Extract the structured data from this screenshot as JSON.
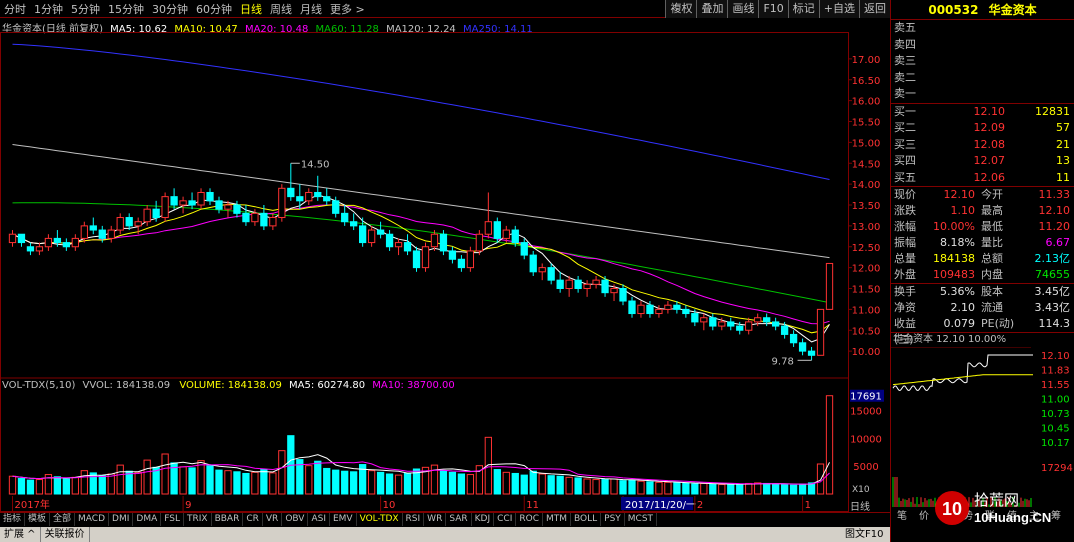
{
  "topbar": {
    "tabs": [
      "分时",
      "1分钟",
      "5分钟",
      "15分钟",
      "30分钟",
      "60分钟",
      "日线",
      "周线",
      "月线",
      "更多 >"
    ],
    "active_tab": "日线",
    "right_buttons": [
      "複权",
      "叠加",
      "画线",
      "F10",
      "标记",
      "+自选",
      "返回"
    ]
  },
  "chart_header": {
    "name": "华金资本(日线 前复权)",
    "ma5": "MA5: 10.62",
    "ma10": "MA10: 10.47",
    "ma20": "MA20: 10.48",
    "ma60": "MA60: 11.28",
    "ma120": "MA120: 12.24",
    "ma250": "MA250: 14.11"
  },
  "price_axis": [
    "17.00",
    "16.50",
    "16.00",
    "15.50",
    "15.00",
    "14.50",
    "14.00",
    "13.50",
    "13.00",
    "12.50",
    "12.00",
    "11.50",
    "11.00",
    "10.50",
    "10.00"
  ],
  "annotations": {
    "high": "14.50",
    "low": "9.78"
  },
  "volume_header": {
    "label": "VOL-TDX(5,10)",
    "vvol": "VVOL: 184138.09",
    "volume": "VOLUME: 184138.09",
    "ma5": "MA5: 60274.80",
    "ma10": "MA10: 38700.00"
  },
  "volume_axis": {
    "top": "17691",
    "ticks": [
      "15000",
      "10000",
      "5000"
    ],
    "unit": "X10"
  },
  "date_axis": {
    "labels": [
      "2017年",
      "9",
      "10",
      "11",
      "2017/11/20/一",
      "2",
      "1"
    ]
  },
  "colors": {
    "up": "#ff3232",
    "down": "#00ffff",
    "ma5": "#ffffff",
    "ma10": "#ffff00",
    "ma20": "#ff00ff",
    "ma60": "#00c000",
    "ma120": "#c0c0c0",
    "ma250": "#3232ff",
    "frame": "#800000"
  },
  "chart_data": {
    "type": "candlestick",
    "title": "华金资本(日线 前复权)",
    "ylim": [
      9.5,
      17.5
    ],
    "candles": [
      [
        12.6,
        12.9,
        12.5,
        12.8
      ],
      [
        12.8,
        12.8,
        12.5,
        12.6
      ],
      [
        12.5,
        12.6,
        12.3,
        12.4
      ],
      [
        12.4,
        12.6,
        12.3,
        12.5
      ],
      [
        12.5,
        12.8,
        12.4,
        12.7
      ],
      [
        12.7,
        12.9,
        12.5,
        12.6
      ],
      [
        12.6,
        12.7,
        12.4,
        12.5
      ],
      [
        12.5,
        12.8,
        12.4,
        12.7
      ],
      [
        12.7,
        13.1,
        12.6,
        13.0
      ],
      [
        13.0,
        13.2,
        12.8,
        12.9
      ],
      [
        12.9,
        13.0,
        12.6,
        12.7
      ],
      [
        12.7,
        13.0,
        12.6,
        12.9
      ],
      [
        12.9,
        13.3,
        12.8,
        13.2
      ],
      [
        13.2,
        13.3,
        12.9,
        13.0
      ],
      [
        13.0,
        13.2,
        12.8,
        13.1
      ],
      [
        13.1,
        13.5,
        13.0,
        13.4
      ],
      [
        13.4,
        13.6,
        13.1,
        13.2
      ],
      [
        13.2,
        13.8,
        13.1,
        13.7
      ],
      [
        13.7,
        13.9,
        13.4,
        13.5
      ],
      [
        13.5,
        13.7,
        13.3,
        13.6
      ],
      [
        13.6,
        13.8,
        13.4,
        13.5
      ],
      [
        13.5,
        13.9,
        13.4,
        13.8
      ],
      [
        13.8,
        13.9,
        13.5,
        13.6
      ],
      [
        13.6,
        13.7,
        13.3,
        13.4
      ],
      [
        13.4,
        13.6,
        13.2,
        13.5
      ],
      [
        13.5,
        13.6,
        13.2,
        13.3
      ],
      [
        13.3,
        13.5,
        13.0,
        13.1
      ],
      [
        13.1,
        13.4,
        13.0,
        13.3
      ],
      [
        13.3,
        13.5,
        12.9,
        13.0
      ],
      [
        13.0,
        13.3,
        12.9,
        13.2
      ],
      [
        13.2,
        14.0,
        13.1,
        13.9
      ],
      [
        13.9,
        14.5,
        13.6,
        13.7
      ],
      [
        13.7,
        14.0,
        13.4,
        13.6
      ],
      [
        13.6,
        13.9,
        13.5,
        13.8
      ],
      [
        13.8,
        14.2,
        13.6,
        13.7
      ],
      [
        13.7,
        13.9,
        13.5,
        13.6
      ],
      [
        13.6,
        13.7,
        13.2,
        13.3
      ],
      [
        13.3,
        13.5,
        13.0,
        13.1
      ],
      [
        13.1,
        13.3,
        12.9,
        13.0
      ],
      [
        13.0,
        13.2,
        12.5,
        12.6
      ],
      [
        12.6,
        13.0,
        12.5,
        12.9
      ],
      [
        12.9,
        13.1,
        12.7,
        12.8
      ],
      [
        12.8,
        12.9,
        12.4,
        12.5
      ],
      [
        12.5,
        12.7,
        12.3,
        12.6
      ],
      [
        12.6,
        12.8,
        12.3,
        12.4
      ],
      [
        12.4,
        12.5,
        11.9,
        12.0
      ],
      [
        12.0,
        12.6,
        11.9,
        12.5
      ],
      [
        12.5,
        12.9,
        12.4,
        12.8
      ],
      [
        12.8,
        12.9,
        12.3,
        12.4
      ],
      [
        12.4,
        12.5,
        12.1,
        12.2
      ],
      [
        12.2,
        12.3,
        11.9,
        12.0
      ],
      [
        12.0,
        12.5,
        11.9,
        12.4
      ],
      [
        12.4,
        12.9,
        12.3,
        12.8
      ],
      [
        12.8,
        13.8,
        12.7,
        13.1
      ],
      [
        13.1,
        13.2,
        12.6,
        12.7
      ],
      [
        12.7,
        13.0,
        12.6,
        12.9
      ],
      [
        12.9,
        13.0,
        12.5,
        12.6
      ],
      [
        12.6,
        12.7,
        12.2,
        12.3
      ],
      [
        12.3,
        12.4,
        11.8,
        11.9
      ],
      [
        11.9,
        12.1,
        11.7,
        12.0
      ],
      [
        12.0,
        12.1,
        11.6,
        11.7
      ],
      [
        11.7,
        11.9,
        11.4,
        11.5
      ],
      [
        11.5,
        11.8,
        11.3,
        11.7
      ],
      [
        11.7,
        11.8,
        11.4,
        11.5
      ],
      [
        11.5,
        11.7,
        11.3,
        11.6
      ],
      [
        11.6,
        11.8,
        11.5,
        11.7
      ],
      [
        11.7,
        11.8,
        11.3,
        11.4
      ],
      [
        11.4,
        11.6,
        11.2,
        11.5
      ],
      [
        11.5,
        11.6,
        11.1,
        11.2
      ],
      [
        11.2,
        11.3,
        10.8,
        10.9
      ],
      [
        10.9,
        11.2,
        10.8,
        11.1
      ],
      [
        11.1,
        11.2,
        10.8,
        10.9
      ],
      [
        10.9,
        11.1,
        10.8,
        11.0
      ],
      [
        11.0,
        11.2,
        10.9,
        11.1
      ],
      [
        11.1,
        11.2,
        10.9,
        11.0
      ],
      [
        11.0,
        11.1,
        10.8,
        10.9
      ],
      [
        10.9,
        11.0,
        10.6,
        10.7
      ],
      [
        10.7,
        10.9,
        10.5,
        10.8
      ],
      [
        10.8,
        10.9,
        10.5,
        10.6
      ],
      [
        10.6,
        10.8,
        10.5,
        10.7
      ],
      [
        10.7,
        10.8,
        10.5,
        10.6
      ],
      [
        10.6,
        10.7,
        10.4,
        10.5
      ],
      [
        10.5,
        10.8,
        10.4,
        10.7
      ],
      [
        10.7,
        10.9,
        10.6,
        10.8
      ],
      [
        10.8,
        10.9,
        10.6,
        10.7
      ],
      [
        10.7,
        10.8,
        10.5,
        10.6
      ],
      [
        10.6,
        10.7,
        10.3,
        10.4
      ],
      [
        10.4,
        10.5,
        10.1,
        10.2
      ],
      [
        10.2,
        10.3,
        9.9,
        10.0
      ],
      [
        10.0,
        10.1,
        9.78,
        9.9
      ],
      [
        9.9,
        11.0,
        9.9,
        11.0
      ],
      [
        11.0,
        12.1,
        11.0,
        12.1
      ]
    ],
    "volumes": [
      3200,
      2800,
      2500,
      2600,
      3500,
      3100,
      2700,
      3000,
      4200,
      3800,
      3300,
      3600,
      5200,
      4100,
      3900,
      6100,
      4800,
      7200,
      5600,
      4900,
      4700,
      6000,
      5100,
      4300,
      4200,
      4000,
      3700,
      3900,
      4400,
      3800,
      7800,
      10500,
      6200,
      5100,
      5900,
      4600,
      4300,
      4100,
      4000,
      5300,
      4200,
      3900,
      3600,
      3400,
      3700,
      4500,
      4800,
      5200,
      4200,
      3900,
      3600,
      3500,
      5100,
      10200,
      4400,
      3900,
      3700,
      3400,
      4100,
      3600,
      3300,
      3200,
      3000,
      2900,
      2700,
      2600,
      2600,
      2700,
      2400,
      2500,
      2300,
      2200,
      2100,
      2100,
      2000,
      1900,
      1800,
      1900,
      1800,
      1700,
      1700,
      1800,
      1900,
      2000,
      1900,
      1800,
      1700,
      1600,
      1800,
      2000,
      5400,
      17691
    ],
    "xlabels": [
      "2017年",
      "9",
      "10",
      "11",
      "2017/11/20/一",
      "2",
      "1"
    ]
  },
  "rpanel": {
    "code": "000532",
    "name": "华金资本",
    "sell": [
      {
        "label": "卖五",
        "price": "",
        "vol": ""
      },
      {
        "label": "卖四",
        "price": "",
        "vol": ""
      },
      {
        "label": "卖三",
        "price": "",
        "vol": ""
      },
      {
        "label": "卖二",
        "price": "",
        "vol": ""
      },
      {
        "label": "卖一",
        "price": "",
        "vol": ""
      }
    ],
    "buy": [
      {
        "label": "买一",
        "price": "12.10",
        "vol": "12831"
      },
      {
        "label": "买二",
        "price": "12.09",
        "vol": "57"
      },
      {
        "label": "买三",
        "price": "12.08",
        "vol": "21"
      },
      {
        "label": "买四",
        "price": "12.07",
        "vol": "13"
      },
      {
        "label": "买五",
        "price": "12.06",
        "vol": "11"
      }
    ],
    "quote": [
      {
        "k": "现价",
        "v": "12.10",
        "vc": "red",
        "k2": "今开",
        "v2": "11.33",
        "v2c": "red"
      },
      {
        "k": "涨跌",
        "v": "1.10",
        "vc": "red",
        "k2": "最高",
        "v2": "12.10",
        "v2c": "red"
      },
      {
        "k": "涨幅",
        "v": "10.00%",
        "vc": "red",
        "k2": "最低",
        "v2": "11.20",
        "v2c": "red"
      },
      {
        "k": "振幅",
        "v": "8.18%",
        "vc": "white",
        "k2": "量比",
        "v2": "6.67",
        "v2c": "magenta"
      },
      {
        "k": "总量",
        "v": "184138",
        "vc": "yellow",
        "k2": "总额",
        "v2": "2.13亿",
        "v2c": "cyan"
      },
      {
        "k": "外盘",
        "v": "109483",
        "vc": "red",
        "k2": "内盘",
        "v2": "74655",
        "v2c": "green"
      }
    ],
    "quote2": [
      {
        "k": "换手",
        "v": "5.36%",
        "vc": "white",
        "k2": "股本",
        "v2": "3.45亿",
        "v2c": "white"
      },
      {
        "k": "净资",
        "v": "2.10",
        "vc": "white",
        "k2": "流通",
        "v2": "3.43亿",
        "v2c": "white"
      },
      {
        "k": "收益(三)",
        "v": "0.079",
        "vc": "white",
        "k2": "PE(动)",
        "v2": "114.3",
        "v2c": "white"
      }
    ],
    "mini_header": "华金资本  12.10  10.00%",
    "mini_axis": [
      "12.10",
      "11.83",
      "11.55",
      "11.00",
      "10.73",
      "10.45",
      "10.17"
    ],
    "mini_vol": "17294",
    "mini_tabs": [
      "笔",
      "价",
      "细",
      "势",
      "联",
      "值",
      "主",
      "筹"
    ]
  },
  "bottom_tabs": [
    "指标",
    "模板",
    "全部",
    "MACD",
    "DMI",
    "DMA",
    "FSL",
    "TRIX",
    "BBAR",
    "CR",
    "VR",
    "OBV",
    "ASI",
    "EMV",
    "VOL-TDX",
    "RSI",
    "WR",
    "SAR",
    "KDJ",
    "CCI",
    "ROC",
    "MTM",
    "BOLL",
    "PSY",
    "MCST"
  ],
  "active_bottom_tab": "VOL-TDX",
  "status_tabs": [
    "扩展 ^",
    "关联报价"
  ],
  "side_tabs": [
    "日线",
    "图文F10"
  ],
  "watermark": {
    "logo": "10",
    "site": "拾荒网",
    "url": "10Huang.CN"
  }
}
